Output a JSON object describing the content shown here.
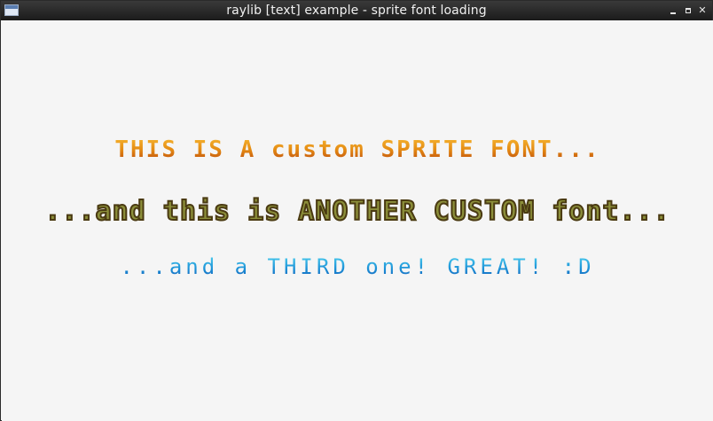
{
  "window": {
    "title": "raylib [text] example - sprite font loading",
    "buttons": [
      "minimize",
      "maximize",
      "close"
    ]
  },
  "content": {
    "line1": "THIS IS A custom SPRITE FONT...",
    "line2": "...and this is ANOTHER CUSTOM font...",
    "line3": "...and a THIRD one! GREAT! :D"
  },
  "colors": {
    "background": "#f5f5f5",
    "titlebar": "#2a2a2a",
    "font1": "#e48a12",
    "font2": "#8c8f3a",
    "font3": "#1a8fd6"
  }
}
